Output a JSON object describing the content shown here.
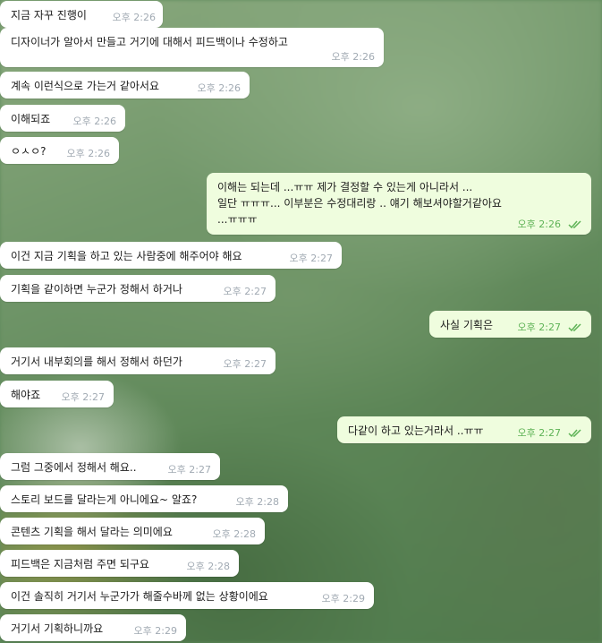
{
  "colors": {
    "incoming_bubble": "#ffffff",
    "outgoing_bubble": "#effdde",
    "outgoing_time": "#5fb357",
    "incoming_time": "#a1aab3"
  },
  "messages": [
    {
      "side": "in",
      "text": "지금 자꾸 진행이",
      "time": "오후 2:26"
    },
    {
      "side": "in",
      "text": "디자이너가 알아서 만들고 거기에 대해서 피드백이나 수정하고",
      "time": "오후 2:26"
    },
    {
      "side": "in",
      "text": "계속 이런식으로 가는거 같아서요",
      "time": "오후 2:26"
    },
    {
      "side": "in",
      "text": "이해되죠",
      "time": "오후 2:26"
    },
    {
      "side": "in",
      "text": "ㅇㅅㅇ?",
      "time": "오후 2:26"
    },
    {
      "side": "out",
      "lines": [
        "이해는 되는데 ...ㅠㅠ 제가 결정할 수 있는게 아니라서 ...",
        "일단 ㅠㅠㅠ... 이부분은 수정대리랑 .. 얘기 해보셔야할거같아요",
        "...ㅠㅠㅠ"
      ],
      "time": "오후 2:26",
      "read": "double-check-icon"
    },
    {
      "side": "in",
      "text": "이건 지금 기획을 하고 있는 사람중에 해주어야 해요",
      "time": "오후 2:27"
    },
    {
      "side": "in",
      "text": "기획을 같이하면 누군가 정해서 하거나",
      "time": "오후 2:27"
    },
    {
      "side": "out",
      "text": "사실 기획은",
      "time": "오후 2:27",
      "read": "double-check-icon"
    },
    {
      "side": "in",
      "text": "거기서 내부회의를 해서 정해서 하던가",
      "time": "오후 2:27"
    },
    {
      "side": "in",
      "text": "해야죠",
      "time": "오후 2:27"
    },
    {
      "side": "out",
      "text": "다같이 하고 있는거라서 ..ㅠㅠ",
      "time": "오후 2:27",
      "read": "double-check-icon"
    },
    {
      "side": "in",
      "text": "그럼 그중에서 정해서 해요..",
      "time": "오후 2:27"
    },
    {
      "side": "in",
      "text": "스토리 보드를 달라는게 아니에요~ 알죠?",
      "time": "오후 2:28"
    },
    {
      "side": "in",
      "text": "콘텐츠 기획을 해서 달라는 의미에요",
      "time": "오후 2:28"
    },
    {
      "side": "in",
      "text": "피드백은 지금처럼 주면 되구요",
      "time": "오후 2:28"
    },
    {
      "side": "in",
      "text": "이건 솔직히 거기서 누군가가 해줄수바께 없는 상황이에요",
      "time": "오후 2:29"
    },
    {
      "side": "in",
      "text": "거기서 기획하니까요",
      "time": "오후 2:29"
    }
  ]
}
